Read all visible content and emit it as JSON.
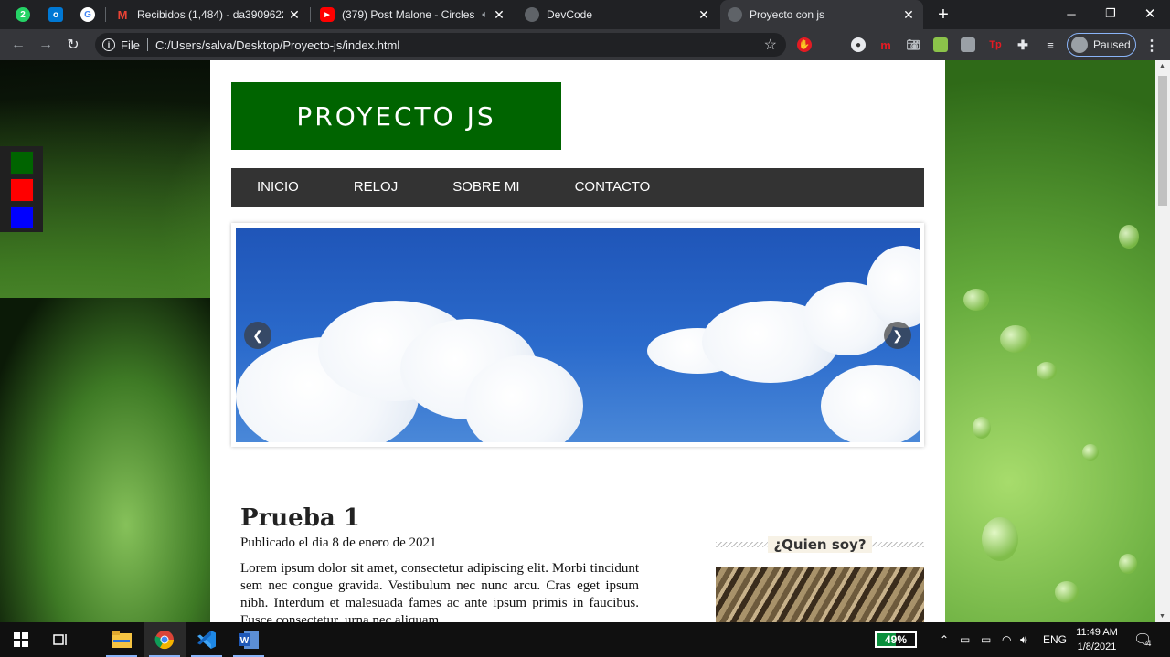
{
  "browser": {
    "pinned_tabs": [
      {
        "icon": "whatsapp-icon",
        "color": "#25d366",
        "glyph": "2"
      },
      {
        "icon": "outlook-icon",
        "color": "#0078d4",
        "glyph": "o"
      },
      {
        "icon": "google-icon",
        "color": "#ffffff",
        "glyph": "G"
      }
    ],
    "tabs": [
      {
        "title": "Recibidos (1,484) - da3909622@",
        "icon": "gmail-icon",
        "color": "#ea4335"
      },
      {
        "title": "(379) Post Malone - Circles -",
        "icon": "youtube-icon",
        "color": "#ff0000"
      },
      {
        "title": "DevCode",
        "icon": "globe-icon",
        "color": "#5f6368"
      },
      {
        "title": "Proyecto con js",
        "icon": "globe-icon",
        "color": "#5f6368"
      }
    ],
    "url_scheme": "File",
    "url": "C:/Users/salva/Desktop/Proyecto-js/index.html",
    "profile_status": "Paused"
  },
  "theme_switcher": {
    "colors": [
      "#006400",
      "#ff0000",
      "#0000ff"
    ]
  },
  "site": {
    "logo": "PROYECTO JS",
    "menu": [
      "INICIO",
      "RELOJ",
      "SOBRE MI",
      "CONTACTO"
    ],
    "post": {
      "title": "Prueba 1",
      "date": "Publicado el dia 8 de enero de 2021",
      "body": "Lorem ipsum dolor sit amet, consectetur adipiscing elit. Morbi tincidunt sem nec congue gravida. Vestibulum nec nunc arcu. Cras eget ipsum nibh. Interdum et malesuada fames ac ante ipsum primis in faucibus. Fusce consectetur, urna nec aliquam"
    },
    "sidebar_title": "¿Quien soy?"
  },
  "taskbar": {
    "battery": "49%",
    "battery_level": 0.49,
    "language": "ENG",
    "time": "11:49 AM",
    "date": "1/8/2021",
    "notifications": "4"
  }
}
